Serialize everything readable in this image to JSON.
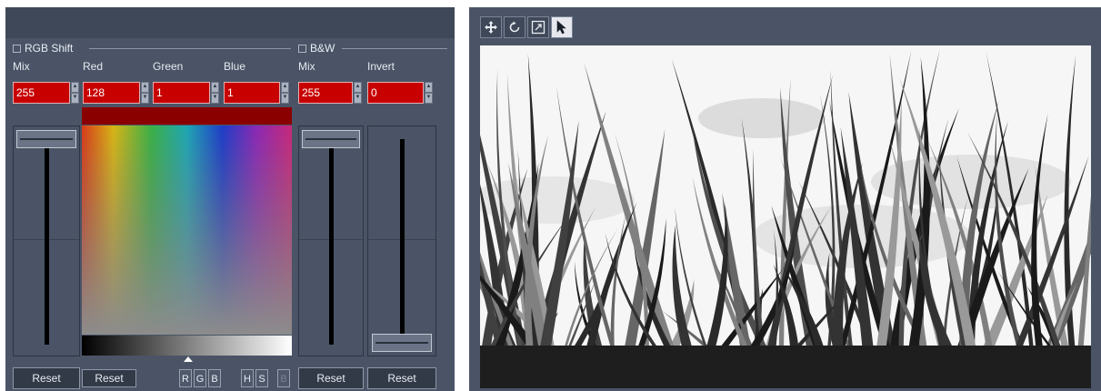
{
  "rgb_shift": {
    "title": "RGB Shift",
    "labels": {
      "mix": "Mix",
      "red": "Red",
      "green": "Green",
      "blue": "Blue"
    },
    "values": {
      "mix": "255",
      "red": "128",
      "green": "1",
      "blue": "1"
    },
    "reset_mix_label": "Reset",
    "reset_color_label": "Reset",
    "channels": [
      "R",
      "G",
      "B",
      "H",
      "S",
      "B"
    ]
  },
  "bw": {
    "title": "B&W",
    "labels": {
      "mix": "Mix",
      "invert": "Invert"
    },
    "values": {
      "mix": "255",
      "invert": "0"
    },
    "reset_mix_label": "Reset",
    "reset_invert_label": "Reset"
  },
  "toolbar": {
    "tools": [
      "move-icon",
      "rotate-icon",
      "fit-icon",
      "pointer-icon"
    ],
    "active_tool": "pointer-icon"
  },
  "preview": {
    "description_icon": "image-preview"
  },
  "colors": {
    "panel_bg": "#4a5466",
    "field_red": "#c80000",
    "accent_dark": "#323a48"
  }
}
